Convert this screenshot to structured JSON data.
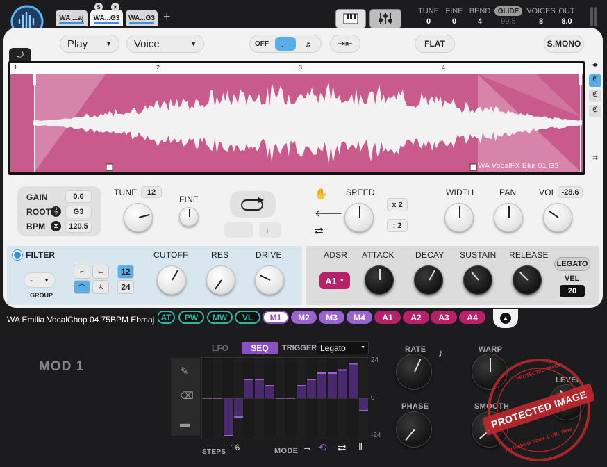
{
  "tabs": [
    {
      "label": "WA ...aj"
    },
    {
      "label": "WA...G3"
    },
    {
      "label": "WA...G3"
    }
  ],
  "tab_badges": {
    "s": "S",
    "x": "✕"
  },
  "add_tab": "+",
  "header": {
    "tune_label": "TUNE",
    "tune_value": "0",
    "fine_label": "FINE",
    "fine_value": "0",
    "bend_label": "BEND",
    "bend_value": "4",
    "glide_label": "GLIDE",
    "glide_value": "99.5",
    "voices_label": "VOICES",
    "voices_value": "8",
    "out_label": "OUT",
    "out_value": "8.0"
  },
  "toolbar": {
    "play_mode": "Play",
    "voice_mode": "Voice",
    "off_label": "OFF",
    "flat_label": "FLAT",
    "smono_label": "S.MONO"
  },
  "waveform": {
    "markers": [
      "1",
      "2",
      "3",
      "4"
    ],
    "sample_name": "WA VocalFX Blur 01 G3",
    "bg_color": "#c85a8c"
  },
  "sample": {
    "gain_label": "GAIN",
    "gain_value": "0.0",
    "root_label": "ROOT",
    "root_value": "G3",
    "bpm_label": "BPM",
    "bpm_value": "120.5",
    "tune_label": "TUNE",
    "tune_value": "12",
    "fine_label": "FINE"
  },
  "playback": {
    "speed_label": "SPEED",
    "x2": "x 2",
    "div2": ": 2",
    "width_label": "WIDTH",
    "pan_label": "PAN",
    "vol_label": "VOL",
    "vol_value": "-28.6"
  },
  "filter": {
    "label": "FILTER",
    "type_value": "-",
    "group_label": "GROUP",
    "slope_12": "12",
    "slope_24": "24",
    "cutoff_label": "CUTOFF",
    "res_label": "RES",
    "drive_label": "DRIVE"
  },
  "adsr": {
    "label": "ADSR",
    "source": "A1",
    "attack_label": "ATTACK",
    "decay_label": "DECAY",
    "sustain_label": "SUSTAIN",
    "release_label": "RELEASE",
    "legato_label": "LEGATO",
    "vel_label": "VEL",
    "vel_value": "20"
  },
  "tooltip": "WA Emilia VocalChop 04 75BPM Ebmaj",
  "mod_tabs": [
    "AT",
    "PW",
    "MW",
    "VL",
    "M1",
    "M2",
    "M3",
    "M4",
    "A1",
    "A2",
    "A3",
    "A4"
  ],
  "mod_panel": {
    "title": "MOD 1",
    "lfo_label": "LFO",
    "seq_label": "SEQ",
    "trigger_label": "TRIGGER",
    "trigger_value": "Legato",
    "steps_label": "STEPS",
    "steps_value": "16",
    "mode_label": "MODE",
    "scale_top": "24",
    "scale_mid": "0",
    "scale_bot": "-24",
    "rate_label": "RATE",
    "phase_label": "PHASE",
    "warp_label": "WARP",
    "smooth_label": "SMOOTH",
    "level_label": "LEVEL"
  },
  "seq_steps": [
    0,
    0,
    -24,
    -12,
    12,
    12,
    8,
    0,
    0,
    8,
    12,
    16,
    16,
    18,
    22,
    -8
  ],
  "watermark": {
    "main": "PROTECTED IMAGE",
    "top": "PROTECTED IMAGE",
    "bottom": "My Website Name & URL Here"
  },
  "colors": {
    "accent_blue": "#3b8ee0",
    "waveform_pink": "#c85a8c",
    "mod_purple": "#8a4fc0",
    "mod_magenta": "#b8206a",
    "mod_teal": "#2fb5a0"
  }
}
